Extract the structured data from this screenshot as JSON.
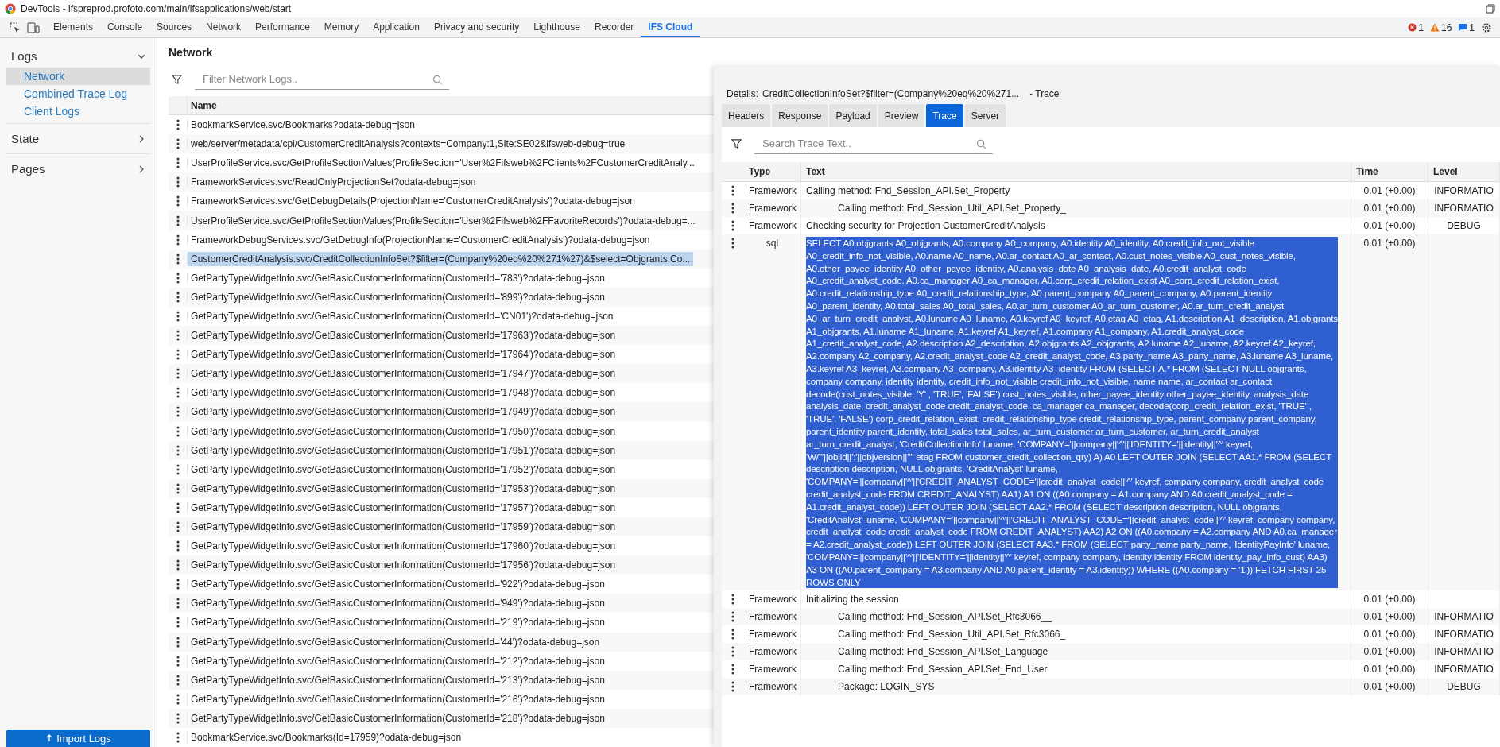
{
  "window": {
    "title": "DevTools - ifspreprod.profoto.com/main/ifsapplications/web/start"
  },
  "devtools_tabs": [
    {
      "label": "Elements",
      "selected": false
    },
    {
      "label": "Console",
      "selected": false
    },
    {
      "label": "Sources",
      "selected": false
    },
    {
      "label": "Network",
      "selected": false
    },
    {
      "label": "Performance",
      "selected": false
    },
    {
      "label": "Memory",
      "selected": false
    },
    {
      "label": "Application",
      "selected": false
    },
    {
      "label": "Privacy and security",
      "selected": false
    },
    {
      "label": "Lighthouse",
      "selected": false
    },
    {
      "label": "Recorder",
      "selected": false
    },
    {
      "label": "IFS Cloud",
      "selected": true
    }
  ],
  "status_counts": {
    "errors": "1",
    "warnings": "16",
    "info": "1"
  },
  "sidebar": {
    "sections": [
      {
        "label": "Logs",
        "expanded": true,
        "items": [
          {
            "label": "Network",
            "selected": true
          },
          {
            "label": "Combined Trace Log",
            "selected": false
          },
          {
            "label": "Client Logs",
            "selected": false
          }
        ]
      },
      {
        "label": "State",
        "expanded": false
      },
      {
        "label": "Pages",
        "expanded": false
      }
    ],
    "import_button": "Import Logs"
  },
  "network": {
    "title": "Network",
    "filter": {
      "placeholder": "Filter Network Logs.."
    },
    "columns": [
      "Name"
    ],
    "rows": [
      {
        "name": "BookmarkService.svc/Bookmarks?odata-debug=json",
        "selected": false
      },
      {
        "name": "web/server/metadata/cpi/CustomerCreditAnalysis?contexts=Company:1,Site:SE02&ifsweb-debug=true",
        "selected": false
      },
      {
        "name": "UserProfileService.svc/GetProfileSectionValues(ProfileSection='User%2Fifsweb%2FClients%2FCustomerCreditAnaly...",
        "selected": false
      },
      {
        "name": "FrameworkServices.svc/ReadOnlyProjectionSet?odata-debug=json",
        "selected": false
      },
      {
        "name": "FrameworkServices.svc/GetDebugDetails(ProjectionName='CustomerCreditAnalysis')?odata-debug=json",
        "selected": false
      },
      {
        "name": "UserProfileService.svc/GetProfileSectionValues(ProfileSection='User%2Fifsweb%2FFavoriteRecords')?odata-debug=...",
        "selected": false
      },
      {
        "name": "FrameworkDebugServices.svc/GetDebugInfo(ProjectionName='CustomerCreditAnalysis')?odata-debug=json",
        "selected": false
      },
      {
        "name": "CustomerCreditAnalysis.svc/CreditCollectionInfoSet?$filter=(Company%20eq%20%271%27)&$select=Objgrants,Co...",
        "selected": true
      },
      {
        "name": "GetPartyTypeWidgetInfo.svc/GetBasicCustomerInformation(CustomerId='783')?odata-debug=json",
        "selected": false
      },
      {
        "name": "GetPartyTypeWidgetInfo.svc/GetBasicCustomerInformation(CustomerId='899')?odata-debug=json",
        "selected": false
      },
      {
        "name": "GetPartyTypeWidgetInfo.svc/GetBasicCustomerInformation(CustomerId='CN01')?odata-debug=json",
        "selected": false
      },
      {
        "name": "GetPartyTypeWidgetInfo.svc/GetBasicCustomerInformation(CustomerId='17963')?odata-debug=json",
        "selected": false
      },
      {
        "name": "GetPartyTypeWidgetInfo.svc/GetBasicCustomerInformation(CustomerId='17964')?odata-debug=json",
        "selected": false
      },
      {
        "name": "GetPartyTypeWidgetInfo.svc/GetBasicCustomerInformation(CustomerId='17947')?odata-debug=json",
        "selected": false
      },
      {
        "name": "GetPartyTypeWidgetInfo.svc/GetBasicCustomerInformation(CustomerId='17948')?odata-debug=json",
        "selected": false
      },
      {
        "name": "GetPartyTypeWidgetInfo.svc/GetBasicCustomerInformation(CustomerId='17949')?odata-debug=json",
        "selected": false
      },
      {
        "name": "GetPartyTypeWidgetInfo.svc/GetBasicCustomerInformation(CustomerId='17950')?odata-debug=json",
        "selected": false
      },
      {
        "name": "GetPartyTypeWidgetInfo.svc/GetBasicCustomerInformation(CustomerId='17951')?odata-debug=json",
        "selected": false
      },
      {
        "name": "GetPartyTypeWidgetInfo.svc/GetBasicCustomerInformation(CustomerId='17952')?odata-debug=json",
        "selected": false
      },
      {
        "name": "GetPartyTypeWidgetInfo.svc/GetBasicCustomerInformation(CustomerId='17953')?odata-debug=json",
        "selected": false
      },
      {
        "name": "GetPartyTypeWidgetInfo.svc/GetBasicCustomerInformation(CustomerId='17957')?odata-debug=json",
        "selected": false
      },
      {
        "name": "GetPartyTypeWidgetInfo.svc/GetBasicCustomerInformation(CustomerId='17959')?odata-debug=json",
        "selected": false
      },
      {
        "name": "GetPartyTypeWidgetInfo.svc/GetBasicCustomerInformation(CustomerId='17960')?odata-debug=json",
        "selected": false
      },
      {
        "name": "GetPartyTypeWidgetInfo.svc/GetBasicCustomerInformation(CustomerId='17956')?odata-debug=json",
        "selected": false
      },
      {
        "name": "GetPartyTypeWidgetInfo.svc/GetBasicCustomerInformation(CustomerId='922')?odata-debug=json",
        "selected": false
      },
      {
        "name": "GetPartyTypeWidgetInfo.svc/GetBasicCustomerInformation(CustomerId='949')?odata-debug=json",
        "selected": false
      },
      {
        "name": "GetPartyTypeWidgetInfo.svc/GetBasicCustomerInformation(CustomerId='219')?odata-debug=json",
        "selected": false
      },
      {
        "name": "GetPartyTypeWidgetInfo.svc/GetBasicCustomerInformation(CustomerId='44')?odata-debug=json",
        "selected": false
      },
      {
        "name": "GetPartyTypeWidgetInfo.svc/GetBasicCustomerInformation(CustomerId='212')?odata-debug=json",
        "selected": false
      },
      {
        "name": "GetPartyTypeWidgetInfo.svc/GetBasicCustomerInformation(CustomerId='213')?odata-debug=json",
        "selected": false
      },
      {
        "name": "GetPartyTypeWidgetInfo.svc/GetBasicCustomerInformation(CustomerId='216')?odata-debug=json",
        "selected": false
      },
      {
        "name": "GetPartyTypeWidgetInfo.svc/GetBasicCustomerInformation(CustomerId='218')?odata-debug=json",
        "selected": false
      },
      {
        "name": "BookmarkService.svc/Bookmarks(Id=17959)?odata-debug=json",
        "selected": false
      }
    ]
  },
  "details": {
    "label": "Details:",
    "request": "CreditCollectionInfoSet?$filter=(Company%20eq%20%271...",
    "suffix": "- Trace",
    "tabs": [
      {
        "label": "Headers",
        "selected": false
      },
      {
        "label": "Response",
        "selected": false
      },
      {
        "label": "Payload",
        "selected": false
      },
      {
        "label": "Preview",
        "selected": false
      },
      {
        "label": "Trace",
        "selected": true
      },
      {
        "label": "Server",
        "selected": false
      }
    ],
    "search": {
      "placeholder": "Search Trace Text.."
    },
    "columns": [
      "Type",
      "Text",
      "Time",
      "Level"
    ],
    "rows": [
      {
        "type": "Framework",
        "text": "Calling method: Fnd_Session_API.Set_Property",
        "time": "0.01 (+0.00)",
        "level": "INFORMATIO",
        "highlighted": false,
        "children": [
          {
            "type": "Framework",
            "text": "Calling method: Fnd_Session_Util_API.Set_Property_",
            "time": "0.01 (+0.00)",
            "level": "INFORMATIO",
            "highlighted": false
          }
        ]
      },
      {
        "type": "Framework",
        "text": "Checking security for Projection CustomerCreditAnalysis",
        "time": "0.01 (+0.00)",
        "level": "DEBUG",
        "highlighted": false
      },
      {
        "type": "sql",
        "text": "SELECT A0.objgrants A0_objgrants, A0.company A0_company, A0.identity A0_identity, A0.credit_info_not_visible A0_credit_info_not_visible, A0.name A0_name, A0.ar_contact A0_ar_contact, A0.cust_notes_visible A0_cust_notes_visible, A0.other_payee_identity A0_other_payee_identity, A0.analysis_date A0_analysis_date, A0.credit_analyst_code A0_credit_analyst_code, A0.ca_manager A0_ca_manager, A0.corp_credit_relation_exist A0_corp_credit_relation_exist, A0.credit_relationship_type A0_credit_relationship_type, A0.parent_company A0_parent_company, A0.parent_identity A0_parent_identity, A0.total_sales A0_total_sales, A0.ar_turn_customer A0_ar_turn_customer, A0.ar_turn_credit_analyst A0_ar_turn_credit_analyst, A0.luname A0_luname, A0.keyref A0_keyref, A0.etag A0_etag, A1.description A1_description, A1.objgrants A1_objgrants, A1.luname A1_luname, A1.keyref A1_keyref, A1.company A1_company, A1.credit_analyst_code A1_credit_analyst_code, A2.description A2_description, A2.objgrants A2_objgrants, A2.luname A2_luname, A2.keyref A2_keyref, A2.company A2_company, A2.credit_analyst_code A2_credit_analyst_code, A3.party_name A3_party_name, A3.luname A3_luname, A3.keyref A3_keyref, A3.company A3_company, A3.identity A3_identity FROM (SELECT A.* FROM (SELECT NULL objgrants, company company, identity identity, credit_info_not_visible credit_info_not_visible, name name, ar_contact ar_contact, decode(cust_notes_visible, 'Y' , 'TRUE', 'FALSE') cust_notes_visible, other_payee_identity other_payee_identity, analysis_date analysis_date, credit_analyst_code credit_analyst_code, ca_manager ca_manager, decode(corp_credit_relation_exist, 'TRUE' , 'TRUE', 'FALSE') corp_credit_relation_exist, credit_relationship_type credit_relationship_type, parent_company parent_company, parent_identity parent_identity, total_sales total_sales, ar_turn_customer ar_turn_customer, ar_turn_credit_analyst ar_turn_credit_analyst, 'CreditCollectionInfo' luname, 'COMPANY='||company||'^'||'IDENTITY='||identity||'^' keyref, 'W/\"'||objid||':'||objversion||'\"' etag FROM customer_credit_collection_qry) A) A0 LEFT OUTER JOIN (SELECT AA1.* FROM (SELECT description description, NULL objgrants, 'CreditAnalyst' luname, 'COMPANY='||company||'^'||'CREDIT_ANALYST_CODE='||credit_analyst_code||'^' keyref, company company, credit_analyst_code credit_analyst_code FROM CREDIT_ANALYST) AA1) A1 ON ((A0.company = A1.company AND A0.credit_analyst_code = A1.credit_analyst_code)) LEFT OUTER JOIN (SELECT AA2.* FROM (SELECT description description, NULL objgrants, 'CreditAnalyst' luname, 'COMPANY='||company||'^'||'CREDIT_ANALYST_CODE='||credit_analyst_code||'^' keyref, company company, credit_analyst_code credit_analyst_code FROM CREDIT_ANALYST) AA2) A2 ON ((A0.company = A2.company AND A0.ca_manager = A2.credit_analyst_code)) LEFT OUTER JOIN (SELECT AA3.* FROM (SELECT party_name party_name, 'IdentityPayInfo' luname, 'COMPANY='||company||'^'||'IDENTITY='||identity||'^' keyref, company company, identity identity FROM identity_pay_info_cust) AA3) A3 ON ((A0.parent_company = A3.company AND A0.parent_identity = A3.identity)) WHERE ((A0.company = '1')) FETCH FIRST 25 ROWS ONLY",
        "time": "0.01 (+0.00)",
        "highlighted": true
      },
      {
        "type": "Framework",
        "text": "Initializing the session",
        "time": "0.01 (+0.00)",
        "highlighted": false,
        "children": [
          {
            "type": "Framework",
            "text": "Calling method: Fnd_Session_API.Set_Rfc3066__",
            "time": "0.01 (+0.00)",
            "level": "INFORMATIO",
            "highlighted": false
          },
          {
            "type": "Framework",
            "text": "Calling method: Fnd_Session_Util_API.Set_Rfc3066_",
            "time": "0.01 (+0.00)",
            "level": "INFORMATIO",
            "highlighted": false
          },
          {
            "type": "Framework",
            "text": "Calling method: Fnd_Session_API.Set_Language",
            "time": "0.01 (+0.00)",
            "level": "INFORMATIO",
            "highlighted": false
          },
          {
            "type": "Framework",
            "text": "Calling method: Fnd_Session_API.Set_Fnd_User",
            "time": "0.01 (+0.00)",
            "level": "INFORMATIO",
            "highlighted": false
          },
          {
            "type": "Framework",
            "text": "Package: LOGIN_SYS",
            "time": "0.01 (+0.00)",
            "level": "DEBUG",
            "highlighted": false
          }
        ]
      }
    ]
  }
}
